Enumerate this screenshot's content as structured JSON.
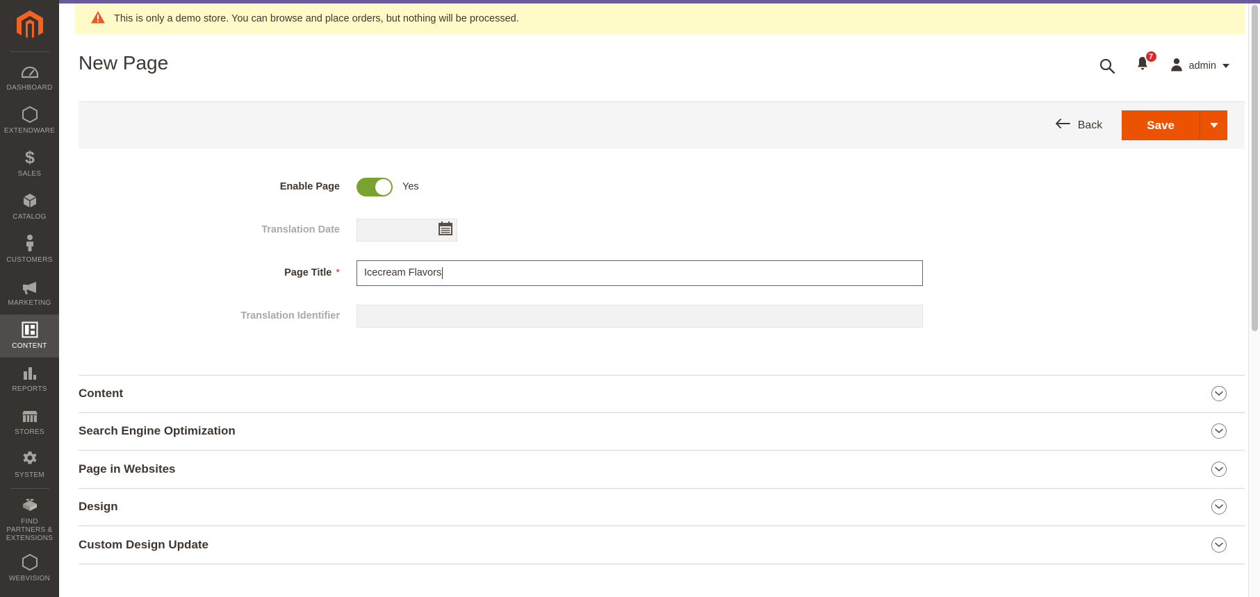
{
  "top_strip_color": "#6b5b9a",
  "brand": {
    "logo_icon": "magento-logo-icon",
    "logo_color": "#f26322"
  },
  "sidebar": {
    "background_color": "#373330",
    "active_background_color": "#4f4c49",
    "items": [
      {
        "label": "Dashboard",
        "icon": "dashboard-icon",
        "active": false
      },
      {
        "label": "Extendware",
        "icon": "hexagon-icon",
        "active": false
      },
      {
        "label": "Sales",
        "icon": "dollar-icon",
        "active": false
      },
      {
        "label": "Catalog",
        "icon": "box-icon",
        "active": false
      },
      {
        "label": "Customers",
        "icon": "person-icon",
        "active": false
      },
      {
        "label": "Marketing",
        "icon": "megaphone-icon",
        "active": false
      },
      {
        "label": "Content",
        "icon": "layout-icon",
        "active": true
      },
      {
        "label": "Reports",
        "icon": "bar-chart-icon",
        "active": false
      },
      {
        "label": "Stores",
        "icon": "storefront-icon",
        "active": false
      },
      {
        "label": "System",
        "icon": "gear-icon",
        "active": false
      },
      {
        "label": "Find Partners & Extensions",
        "icon": "brick-icon",
        "active": false
      },
      {
        "label": "Webvision",
        "icon": "hexagon-icon",
        "active": false
      }
    ]
  },
  "banner": {
    "icon": "warning-triangle-icon",
    "text": "This is only a demo store. You can browse and place orders, but nothing will be processed.",
    "background_color": "#fffbc8"
  },
  "header": {
    "title": "New Page",
    "search_icon": "search-icon",
    "notifications_icon": "bell-icon",
    "notifications_count": "7",
    "notifications_badge_color": "#e22626",
    "user_icon": "user-avatar-icon",
    "user_name": "admin",
    "user_caret_icon": "caret-down-icon"
  },
  "toolbar": {
    "back_arrow_icon": "arrow-left-icon",
    "back_label": "Back",
    "save_label": "Save",
    "save_color": "#eb5202",
    "save_dropdown_icon": "caret-down-icon"
  },
  "form": {
    "fields": [
      {
        "label": "Enable Page",
        "type": "toggle",
        "value": "Yes",
        "enabled": true,
        "required": false,
        "toggle_on": true,
        "toggle_color": "#79a22e"
      },
      {
        "label": "Translation Date",
        "type": "date",
        "value": "",
        "enabled": false,
        "required": false,
        "calendar_icon": "calendar-icon"
      },
      {
        "label": "Page Title",
        "type": "text",
        "value": "Icecream Flavors",
        "enabled": true,
        "required": true,
        "focused": true,
        "focus_border_color": "#007bdb"
      },
      {
        "label": "Translation Identifier",
        "type": "text",
        "value": "",
        "enabled": false,
        "required": false
      }
    ],
    "required_marker": "*"
  },
  "sections": [
    {
      "title": "Content",
      "expanded": false,
      "icon": "chevron-down-icon"
    },
    {
      "title": "Search Engine Optimization",
      "expanded": false,
      "icon": "chevron-down-icon"
    },
    {
      "title": "Page in Websites",
      "expanded": false,
      "icon": "chevron-down-icon"
    },
    {
      "title": "Design",
      "expanded": false,
      "icon": "chevron-down-icon"
    },
    {
      "title": "Custom Design Update",
      "expanded": false,
      "icon": "chevron-down-icon"
    }
  ]
}
